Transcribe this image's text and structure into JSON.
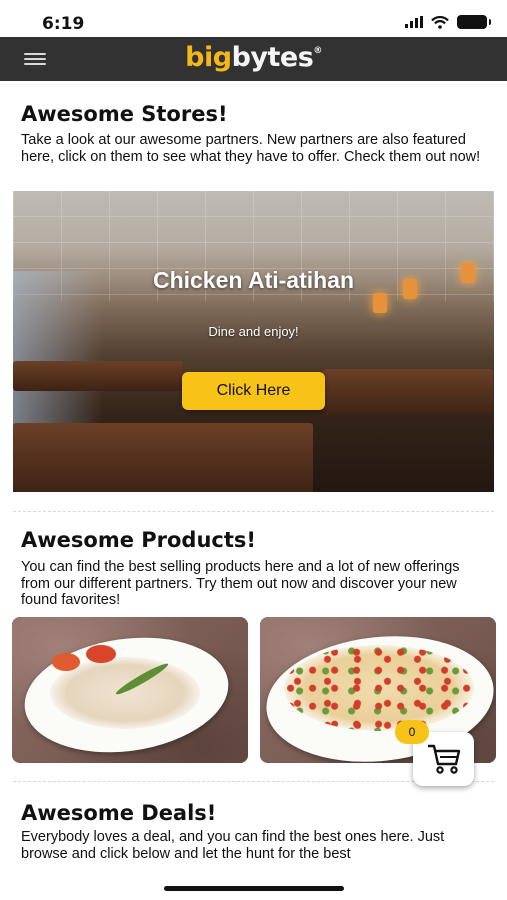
{
  "status_bar": {
    "time": "6:19"
  },
  "header": {
    "logo_big": "big",
    "logo_bytes": "bytes",
    "logo_mark": "®",
    "menu_icon": "hamburger-menu-icon"
  },
  "stores": {
    "title": "Awesome Stores!",
    "description": "Take a look at our awesome partners. New partners are also featured here, click on them to see what they have to offer. Check them out now!",
    "banner": {
      "name": "Chicken Ati-atihan",
      "tagline": "Dine and enjoy!",
      "button_label": "Click Here"
    }
  },
  "products": {
    "title": "Awesome Products!",
    "description": "You can find the best selling products here and a lot of new offerings from our different partners. Try them out now and discover your new found favorites!"
  },
  "cart": {
    "count": "0",
    "icon": "shopping-cart-icon"
  },
  "deals": {
    "title": "Awesome Deals!",
    "description": "Everybody loves a deal, and you can find the best ones here. Just browse and click below and let the hunt for the best"
  },
  "colors": {
    "accent": "#f7c316",
    "header_bg": "#323232",
    "logo_big": "#f5b81b"
  }
}
